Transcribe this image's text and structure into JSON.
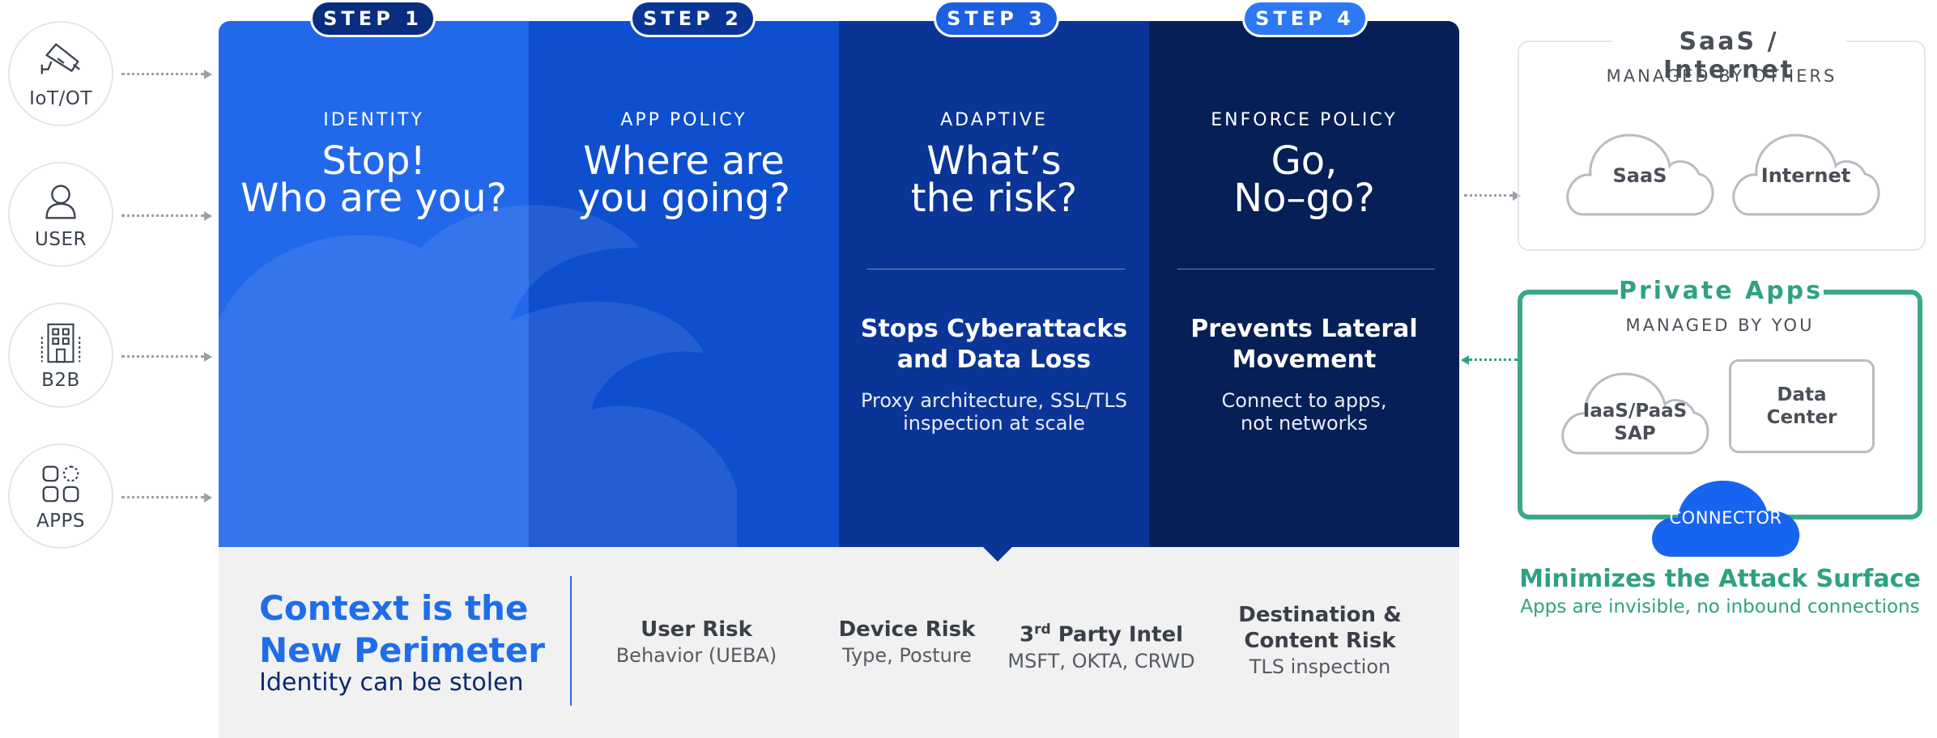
{
  "entities": [
    {
      "label": "IoT/OT",
      "icon": "camera-icon"
    },
    {
      "label": "USER",
      "icon": "user-icon"
    },
    {
      "label": "B2B",
      "icon": "building-icon"
    },
    {
      "label": "APPS",
      "icon": "apps-grid-icon"
    }
  ],
  "steps": [
    {
      "badge": "STEP 1",
      "category": "IDENTITY",
      "question_l1": "Stop!",
      "question_l2": "Who are you?"
    },
    {
      "badge": "STEP 2",
      "category": "APP POLICY",
      "question_l1": "Where are",
      "question_l2": "you going?"
    },
    {
      "badge": "STEP 3",
      "category": "ADAPTIVE",
      "question_l1": "What’s",
      "question_l2": "the risk?",
      "body_heading_l1": "Stops Cyberattacks",
      "body_heading_l2": "and Data Loss",
      "body_text_l1": "Proxy architecture, SSL/TLS",
      "body_text_l2": "inspection at scale"
    },
    {
      "badge": "STEP 4",
      "category": "ENFORCE POLICY",
      "question_l1": "Go,",
      "question_l2": "No–go?",
      "body_heading_l1": "Prevents Lateral",
      "body_heading_l2": "Movement",
      "body_text_l1": "Connect to apps,",
      "body_text_l2": "not networks"
    }
  ],
  "context": {
    "title_l1": "Context is the",
    "title_l2": "New Perimeter",
    "subtitle": "Identity can be stolen",
    "risks": [
      {
        "h": "User Risk",
        "s": "Behavior (UEBA)"
      },
      {
        "h": "Device Risk",
        "s": "Type, Posture"
      },
      {
        "h_pre": "3",
        "h_sup": "rd",
        "h_post": " Party Intel",
        "s": "MSFT, OKTA, CRWD"
      },
      {
        "h_l1": "Destination &",
        "h_l2": "Content Risk",
        "s": "TLS inspection"
      }
    ]
  },
  "saas_box": {
    "title": "SaaS / Internet",
    "subtitle": "MANAGED BY OTHERS",
    "clouds": [
      "SaaS",
      "Internet"
    ]
  },
  "private_box": {
    "title": "Private Apps",
    "subtitle": "MANAGED BY YOU",
    "cloud_l1": "IaaS/PaaS",
    "cloud_l2": "SAP",
    "dc_l1": "Data",
    "dc_l2": "Center",
    "connector": "CONNECTOR"
  },
  "attack_surface": {
    "title": "Minimizes the Attack Surface",
    "subtitle": "Apps are invisible, no inbound connections"
  },
  "colors": {
    "step1": "#2268ea",
    "step2": "#0e4fcf",
    "step3": "#0a3596",
    "step4": "#061f56",
    "accent_blue": "#1f6ee8",
    "green": "#2fa183"
  }
}
